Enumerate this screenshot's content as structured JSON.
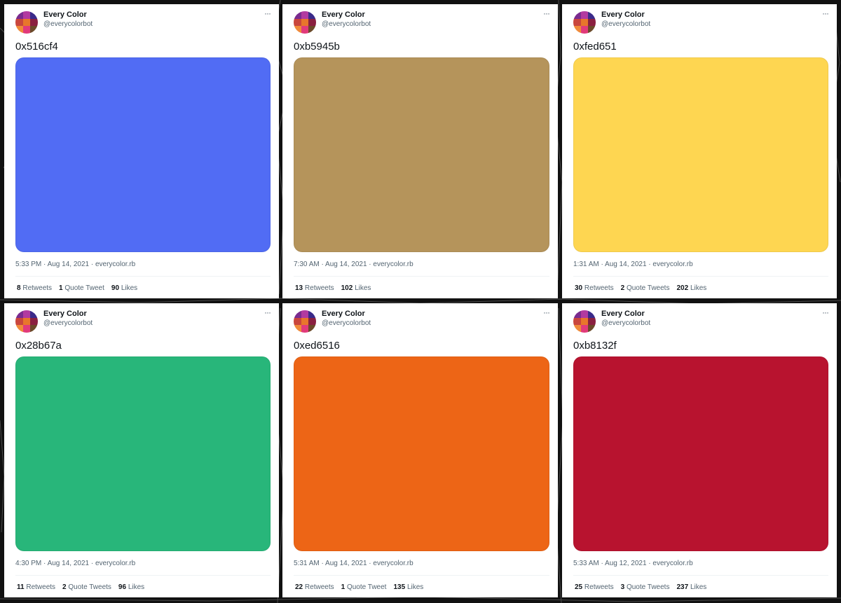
{
  "avatar_colors": [
    "#7a2b8f",
    "#b23aa0",
    "#3a2a8a",
    "#c9463d",
    "#e8762b",
    "#8a2040",
    "#f08a3a",
    "#e13a7a",
    "#6b4a2a"
  ],
  "tweets": [
    {
      "name": "Every Color",
      "handle": "@everycolorbot",
      "more": "···",
      "hex": "0x516cf4",
      "color": "#516cf4",
      "meta": "5:33 PM · Aug 14, 2021 · everycolor.rb",
      "stats": [
        {
          "n": "8",
          "label": "Retweets"
        },
        {
          "n": "1",
          "label": "Quote Tweet"
        },
        {
          "n": "90",
          "label": "Likes"
        }
      ]
    },
    {
      "name": "Every Color",
      "handle": "@everycolorbot",
      "more": "···",
      "hex": "0xb5945b",
      "color": "#b5945b",
      "meta": "7:30 AM · Aug 14, 2021 · everycolor.rb",
      "stats": [
        {
          "n": "13",
          "label": "Retweets"
        },
        {
          "n": "102",
          "label": "Likes"
        }
      ]
    },
    {
      "name": "Every Color",
      "handle": "@everycolorbot",
      "more": "···",
      "hex": "0xfed651",
      "color": "#fed651",
      "meta": "1:31 AM · Aug 14, 2021 · everycolor.rb",
      "stats": [
        {
          "n": "30",
          "label": "Retweets"
        },
        {
          "n": "2",
          "label": "Quote Tweets"
        },
        {
          "n": "202",
          "label": "Likes"
        }
      ]
    },
    {
      "name": "Every Color",
      "handle": "@everycolorbot",
      "more": "···",
      "hex": "0x28b67a",
      "color": "#28b67a",
      "meta": "4:30 PM · Aug 14, 2021 · everycolor.rb",
      "stats": [
        {
          "n": "11",
          "label": "Retweets"
        },
        {
          "n": "2",
          "label": "Quote Tweets"
        },
        {
          "n": "96",
          "label": "Likes"
        }
      ]
    },
    {
      "name": "Every Color",
      "handle": "@everycolorbot",
      "more": "···",
      "hex": "0xed6516",
      "color": "#ed6516",
      "meta": "5:31 AM · Aug 14, 2021 · everycolor.rb",
      "stats": [
        {
          "n": "22",
          "label": "Retweets"
        },
        {
          "n": "1",
          "label": "Quote Tweet"
        },
        {
          "n": "135",
          "label": "Likes"
        }
      ]
    },
    {
      "name": "Every Color",
      "handle": "@everycolorbot",
      "more": "···",
      "hex": "0xb8132f",
      "color": "#b8132f",
      "meta": "5:33 AM · Aug 12, 2021 · everycolor.rb",
      "stats": [
        {
          "n": "25",
          "label": "Retweets"
        },
        {
          "n": "3",
          "label": "Quote Tweets"
        },
        {
          "n": "237",
          "label": "Likes"
        }
      ]
    }
  ]
}
